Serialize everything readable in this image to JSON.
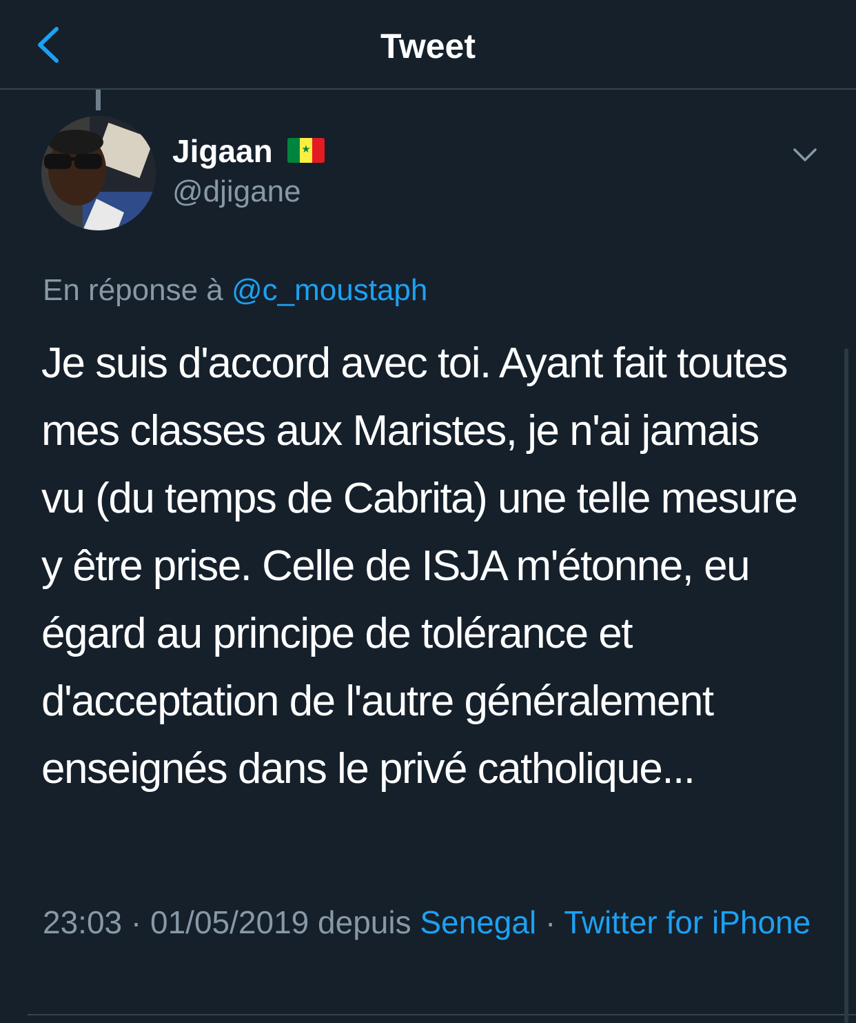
{
  "header": {
    "title": "Tweet",
    "back_icon": "chevron-left-icon"
  },
  "author": {
    "name": "Jigaan",
    "flag_icon": "senegal-flag-icon",
    "handle": "@djigane"
  },
  "reply_to": {
    "prefix": "En réponse à",
    "handle": "@c_moustaph"
  },
  "tweet": {
    "text": "Je suis d'accord avec toi. Ayant fait toutes mes classes aux Maristes, je n'ai jamais vu (du temps de Cabrita) une telle mesure y être prise. Celle de ISJA m'étonne, eu égard au principe de tolérance et d'acceptation de l'autre généralement enseignés dans le privé catholique..."
  },
  "meta": {
    "time": "23:03",
    "sep1": "·",
    "date": "01/05/2019",
    "from": "depuis",
    "location": "Senegal",
    "sep2": "·",
    "client": "Twitter for iPhone"
  },
  "colors": {
    "background": "#15202b",
    "accent": "#1da1f2",
    "secondary_text": "#8899a6",
    "divider": "#38444d"
  }
}
